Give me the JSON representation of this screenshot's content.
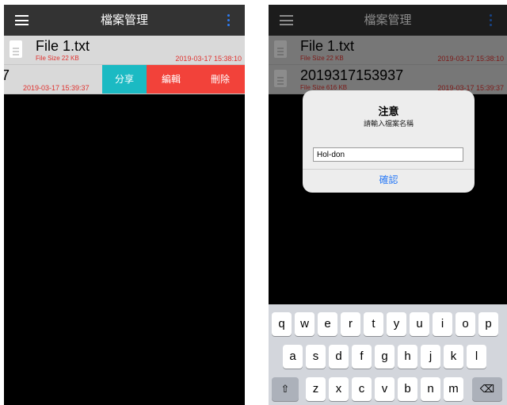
{
  "app": {
    "title": "檔案管理"
  },
  "left": {
    "files": [
      {
        "name": "File 1.txt",
        "size": "File Size  22 KB",
        "date": "2019-03-17 15:38:10"
      },
      {
        "name": "7",
        "date": "2019-03-17 15:39:37"
      }
    ],
    "actions": {
      "share": "分享",
      "edit": "編輯",
      "delete": "刪除"
    },
    "colors": {
      "share": "#1bbac3",
      "edit": "#f2423a",
      "delete": "#f2423a"
    }
  },
  "right": {
    "files": [
      {
        "name": "File 1.txt",
        "size": "File Size  22 KB",
        "date": "2019-03-17 15:38:10"
      },
      {
        "name": "2019317153937",
        "size": "File Size  616 KB",
        "date": "2019-03-17 15:39:37"
      }
    ],
    "dialog": {
      "title": "注意",
      "message": "請輸入檔案名稱",
      "input_value": "Hol-don",
      "ok": "確認"
    },
    "keyboard": {
      "row1": [
        "q",
        "w",
        "e",
        "r",
        "t",
        "y",
        "u",
        "i",
        "o",
        "p"
      ],
      "row2": [
        "a",
        "s",
        "d",
        "f",
        "g",
        "h",
        "j",
        "k",
        "l"
      ],
      "row3": [
        "z",
        "x",
        "c",
        "v",
        "b",
        "n",
        "m"
      ],
      "shift": "⇧",
      "backspace": "⌫"
    }
  }
}
